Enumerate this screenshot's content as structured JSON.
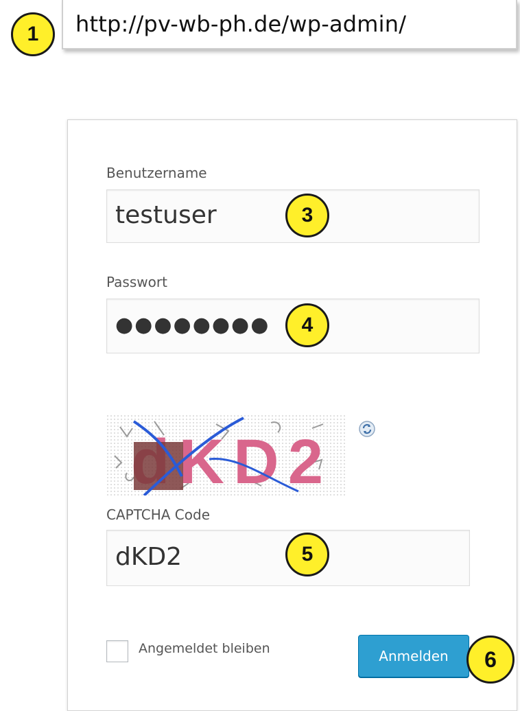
{
  "browser": {
    "url": "http://pv-wb-ph.de/wp-admin/"
  },
  "markers": {
    "m1": "1",
    "m3": "3",
    "m4": "4",
    "m5": "5",
    "m6": "6"
  },
  "login": {
    "username_label": "Benutzername",
    "username_value": "testuser",
    "password_label": "Passwort",
    "password_value": "●●●●●●●●",
    "captcha_image_text": "dKD2",
    "captcha_label": "CAPTCHA Code",
    "captcha_value": "dKD2",
    "remember_label": "Angemeldet bleiben",
    "remember_checked": false,
    "submit_label": "Anmelden"
  },
  "colors": {
    "marker_fill": "#ffef2a",
    "button_blue": "#2e9fd1",
    "captcha_dark": "#7a3b3b",
    "captcha_pink": "#d9668c",
    "captcha_line": "#2a5bd7"
  },
  "icons": {
    "refresh": "refresh-icon"
  }
}
